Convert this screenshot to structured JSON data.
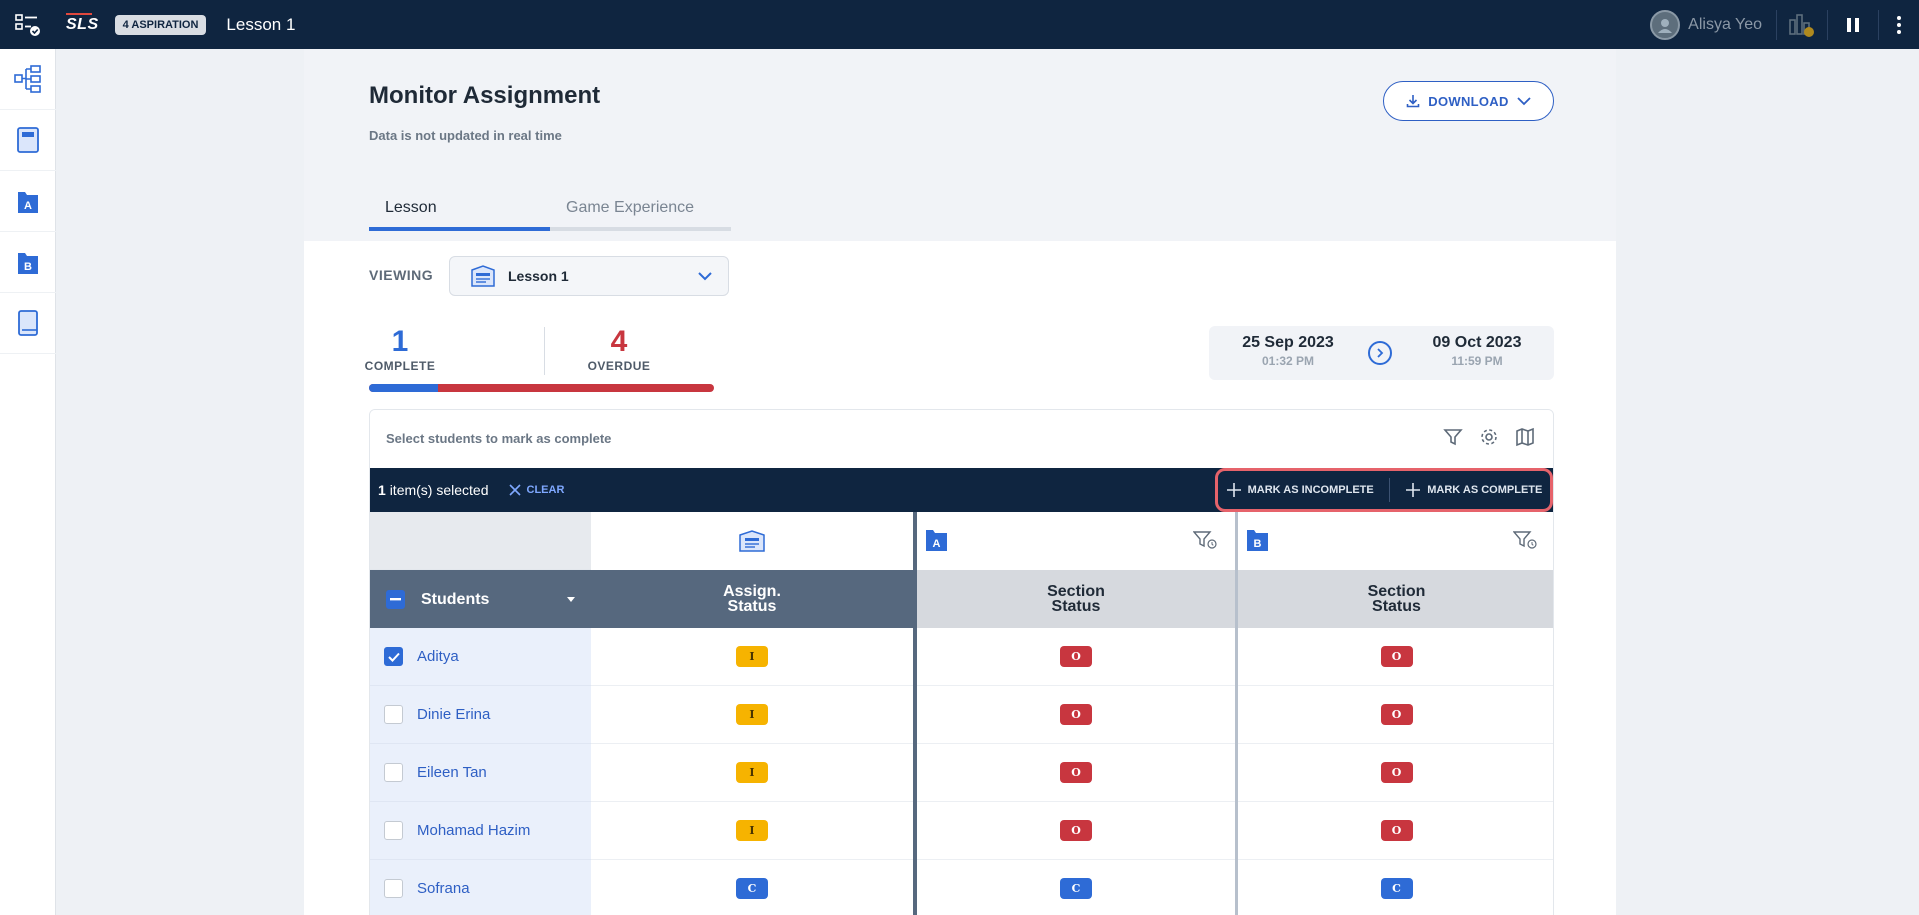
{
  "topbar": {
    "logo": "SLS",
    "class_badge": "4 ASPIRATION",
    "title": "Lesson 1",
    "user_name": "Alisya Yeo"
  },
  "sidebar": {
    "items": [
      {
        "icon": "lesson-map-icon"
      },
      {
        "icon": "notebook-icon"
      },
      {
        "icon": "section-a-icon",
        "label": "A"
      },
      {
        "icon": "section-b-icon",
        "label": "B"
      },
      {
        "icon": "book-icon"
      }
    ]
  },
  "header": {
    "title": "Monitor Assignment",
    "subtitle": "Data is not updated in real time",
    "download_label": "DOWNLOAD",
    "tabs": [
      {
        "label": "Lesson",
        "active": true
      },
      {
        "label": "Game Experience",
        "active": false
      }
    ]
  },
  "viewing": {
    "label": "VIEWING",
    "selected": "Lesson 1"
  },
  "stats": {
    "complete_count": "1",
    "complete_label": "COMPLETE",
    "overdue_count": "4",
    "overdue_label": "OVERDUE",
    "complete_fraction": 0.2
  },
  "dates": {
    "start_date": "25 Sep 2023",
    "start_time": "01:32 PM",
    "end_date": "09 Oct 2023",
    "end_time": "11:59 PM"
  },
  "table": {
    "hint": "Select students to mark as complete",
    "selection": {
      "count": "1",
      "suffix": "item(s) selected",
      "clear_label": "CLEAR",
      "mark_incomplete_label": "MARK AS INCOMPLETE",
      "mark_complete_label": "MARK AS COMPLETE"
    },
    "columns": {
      "students": "Students",
      "assign_status": "Assign.\nStatus",
      "section_a_status": "Section\nStatus",
      "section_b_status": "Section\nStatus",
      "section_a_label": "A",
      "section_b_label": "B"
    },
    "rows": [
      {
        "name": "Aditya",
        "selected": true,
        "assign": "I",
        "sec_a": "O",
        "sec_b": "O"
      },
      {
        "name": "Dinie Erina",
        "selected": false,
        "assign": "I",
        "sec_a": "O",
        "sec_b": "O"
      },
      {
        "name": "Eileen Tan",
        "selected": false,
        "assign": "I",
        "sec_a": "O",
        "sec_b": "O"
      },
      {
        "name": "Mohamad Hazim",
        "selected": false,
        "assign": "I",
        "sec_a": "O",
        "sec_b": "O"
      },
      {
        "name": "Sofrana",
        "selected": false,
        "assign": "C",
        "sec_a": "C",
        "sec_b": "C"
      }
    ]
  },
  "colors": {
    "topbar": "#0f2540",
    "accent": "#2e6bd6",
    "overdue": "#c8363f",
    "in_progress": "#f6b300"
  }
}
